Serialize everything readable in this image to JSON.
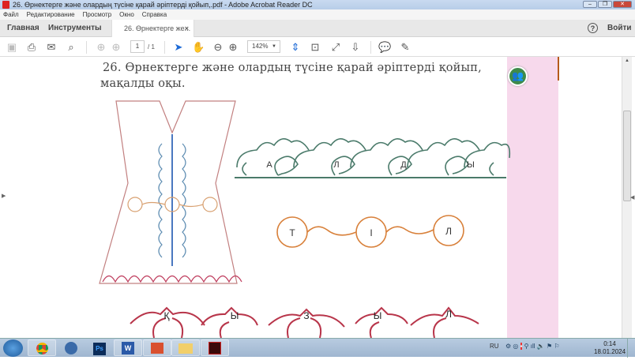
{
  "window": {
    "title": "26. Өрнектерге және олардың түсіне қарай әріптерді қойып,.pdf - Adobe Acrobat Reader DC",
    "minimize": "–",
    "restore": "❐",
    "close": "✕"
  },
  "menu": [
    "Файл",
    "Редактирование",
    "Просмотр",
    "Окно",
    "Справка"
  ],
  "tabs": {
    "home": "Главная",
    "tools": "Инструменты",
    "document": "26. Өрнектерге же...",
    "close": "×",
    "help": "?",
    "signin": "Войти"
  },
  "toolbar": {
    "page_current": "1",
    "page_total": "/ 1",
    "zoom": "142%"
  },
  "document": {
    "heading_line1": "26. Өрнектерге және олардың түсіне қарай әріптерді қойып,",
    "heading_line2": "мақалды оқы.",
    "green_row": [
      "А",
      "Л",
      "Д",
      "Ы"
    ],
    "orange_row": [
      "Т",
      "І",
      "Л"
    ],
    "red_row": [
      "Қ",
      "Ы",
      "З",
      "Ы",
      "Л"
    ]
  },
  "taskbar": {
    "apps": [
      "chrome",
      "media",
      "photoshop",
      "word",
      "powerpoint",
      "explorer",
      "acrobat"
    ],
    "ps": "Ps",
    "word": "W",
    "lang": "RU",
    "time": "0:14",
    "date": "18.01.2024"
  },
  "colors": {
    "green": "#4a7a6a",
    "orange": "#d8803a",
    "red": "#b8354a",
    "blue": "#4a78c0"
  }
}
